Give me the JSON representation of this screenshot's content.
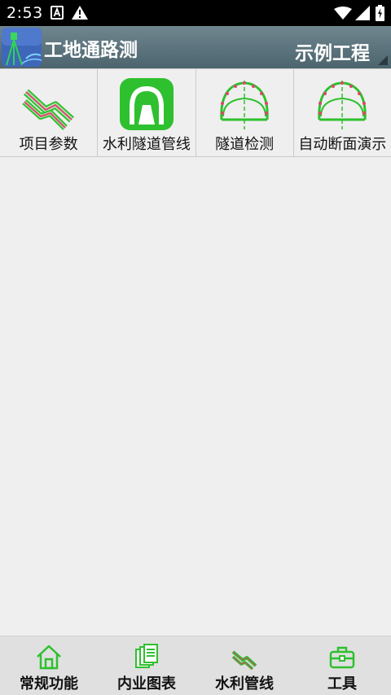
{
  "status_bar": {
    "time": "2:53",
    "icons": [
      "a-notification-icon",
      "warning-icon",
      "wifi-icon",
      "signal-icon",
      "battery-icon"
    ]
  },
  "app_bar": {
    "title": "工地通路测",
    "project": "示例工程",
    "accent_color": "#4c646d"
  },
  "functions": [
    {
      "label": "项目参数",
      "icon": "route-params-icon"
    },
    {
      "label": "水利隧道管线",
      "icon": "tunnel-green-icon"
    },
    {
      "label": "隧道检测",
      "icon": "tunnel-inspect-icon"
    },
    {
      "label": "自动断面演示",
      "icon": "tunnel-section-icon"
    }
  ],
  "bottom_nav": [
    {
      "label": "常规功能",
      "icon": "home-icon"
    },
    {
      "label": "内业图表",
      "icon": "documents-icon"
    },
    {
      "label": "水利管线",
      "icon": "pipeline-icon"
    },
    {
      "label": "工具",
      "icon": "toolbox-icon"
    }
  ],
  "colors": {
    "icon_green": "#2ec02e",
    "point_red": "#e0446e"
  }
}
